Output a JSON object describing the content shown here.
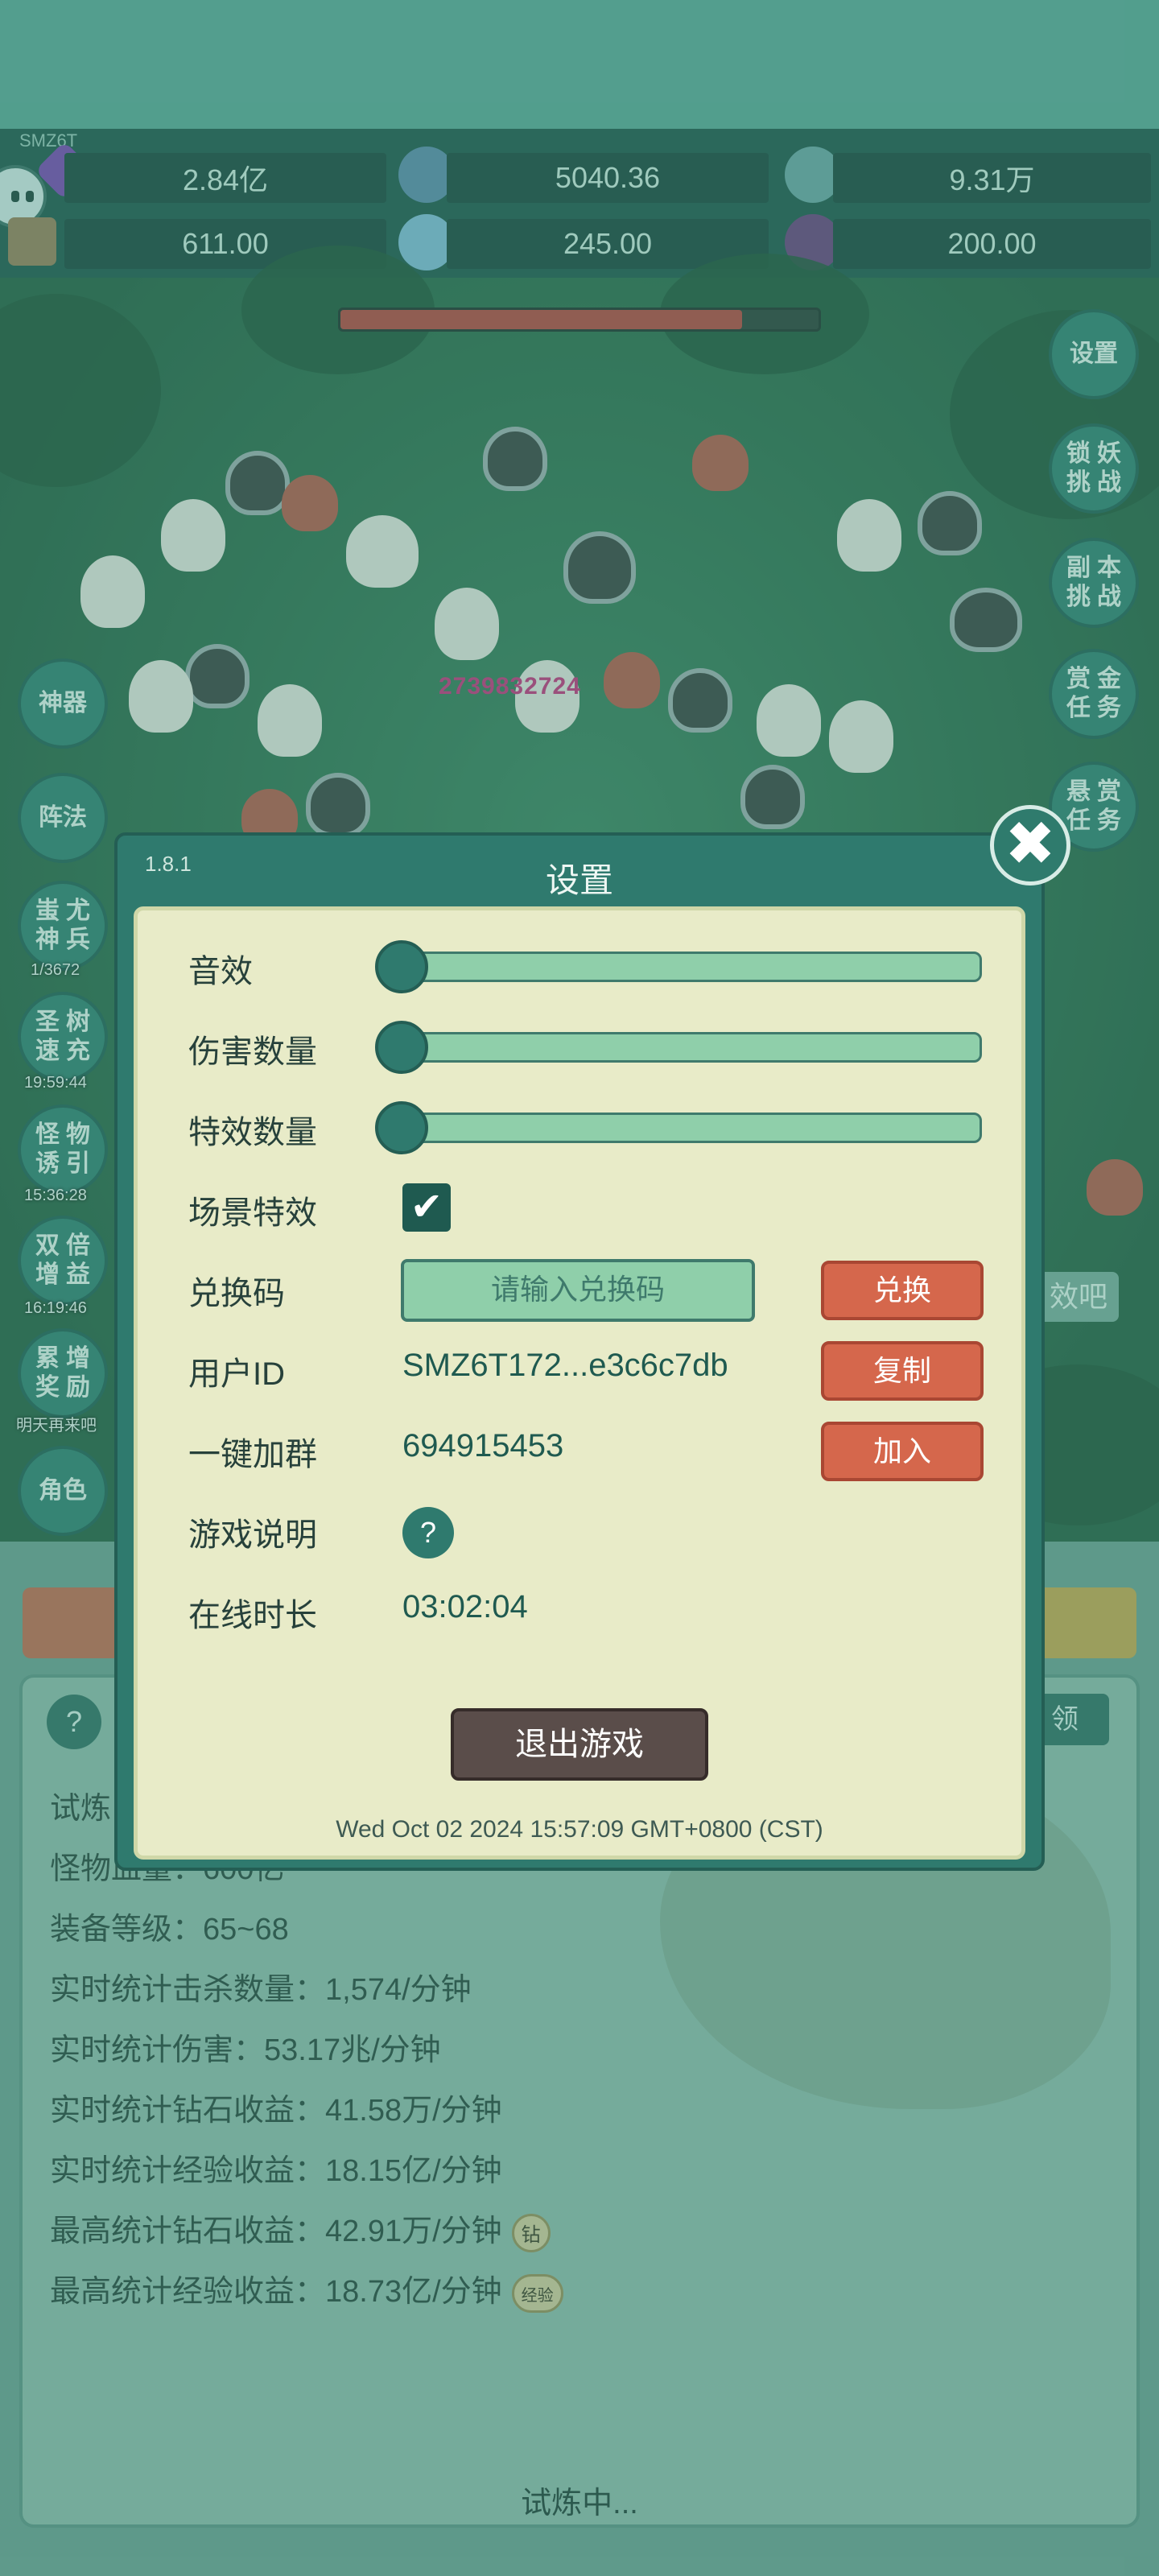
{
  "resources": {
    "smz_tag": "SMZ6T",
    "row1": [
      "2.84亿",
      "5040.36",
      "9.31万"
    ],
    "row2": [
      "611.00",
      "245.00",
      "200.00"
    ]
  },
  "battle": {
    "damage_number": "2739832724",
    "boss_hp_fraction": 0.84
  },
  "right_buttons": [
    {
      "label": "设置"
    },
    {
      "label": "锁妖挑战",
      "chars": [
        "锁",
        "妖",
        "挑",
        "战"
      ]
    },
    {
      "label": "副本挑战",
      "chars": [
        "副",
        "本",
        "挑",
        "战"
      ]
    },
    {
      "label": "赏金任务",
      "chars": [
        "赏",
        "金",
        "任",
        "务"
      ]
    },
    {
      "label": "悬赏任务",
      "chars": [
        "悬",
        "赏",
        "任",
        "务"
      ]
    }
  ],
  "left_buttons": [
    {
      "label": "神器"
    },
    {
      "label": "阵法"
    },
    {
      "label": "蚩尤神兵",
      "chars": [
        "蚩",
        "尤",
        "神",
        "兵"
      ],
      "sub": "1/3672"
    },
    {
      "label": "圣树速充",
      "chars": [
        "圣",
        "树",
        "速",
        "充"
      ],
      "sub": "19:59:44"
    },
    {
      "label": "怪物诱引",
      "chars": [
        "怪",
        "物",
        "诱",
        "引"
      ],
      "sub": "15:36:28"
    },
    {
      "label": "双倍增益",
      "chars": [
        "双",
        "倍",
        "增",
        "益"
      ],
      "sub": "16:19:46"
    },
    {
      "label": "累增奖励",
      "chars": [
        "累",
        "增",
        "奖",
        "励"
      ],
      "sub": "明天再来吧"
    },
    {
      "label": "角色"
    }
  ],
  "partial_labels": {
    "right_side_fragment": "效吧",
    "right_panel_fragment": "领",
    "left_panel_fragment": "试炼"
  },
  "settings_dialog": {
    "version": "1.8.1",
    "title": "设置",
    "close_icon": "✖",
    "sliders": [
      {
        "label": "音效",
        "value": 0
      },
      {
        "label": "伤害数量",
        "value": 0
      },
      {
        "label": "特效数量",
        "value": 0
      }
    ],
    "scene_effects": {
      "label": "场景特效",
      "checked": true
    },
    "redeem": {
      "label": "兑换码",
      "placeholder": "请输入兑换码",
      "button": "兑换"
    },
    "user_id": {
      "label": "用户ID",
      "value": "SMZ6T172...e3c6c7db",
      "button": "复制"
    },
    "join_group": {
      "label": "一键加群",
      "value": "694915453",
      "button": "加入"
    },
    "game_help": {
      "label": "游戏说明",
      "icon": "?"
    },
    "online_time": {
      "label": "在线时长",
      "value": "03:02:04"
    },
    "exit_button": "退出游戏",
    "date": "Wed Oct 02 2024 15:57:09 GMT+0800 (CST)"
  },
  "stats": {
    "help_icon": "?",
    "lines": [
      {
        "text": "怪物血量：600亿"
      },
      {
        "text": "装备等级：65~68"
      },
      {
        "text": "实时统计击杀数量：1,574/分钟"
      },
      {
        "text": "实时统计伤害：53.17兆/分钟"
      },
      {
        "text": "实时统计钻石收益：41.58万/分钟"
      },
      {
        "text": "实时统计经验收益：18.15亿/分钟"
      },
      {
        "text": "最高统计钻石收益：42.91万/分钟",
        "badge": "钻"
      },
      {
        "text": "最高统计经验收益：18.73亿/分钟",
        "badge": "经验"
      }
    ],
    "status": "试炼中..."
  },
  "colors": {
    "accent": "#2f7a6e",
    "dialog_bg": "#e8ebc8",
    "action_button": "#d5674c",
    "exit_button": "#5a4d4a"
  }
}
